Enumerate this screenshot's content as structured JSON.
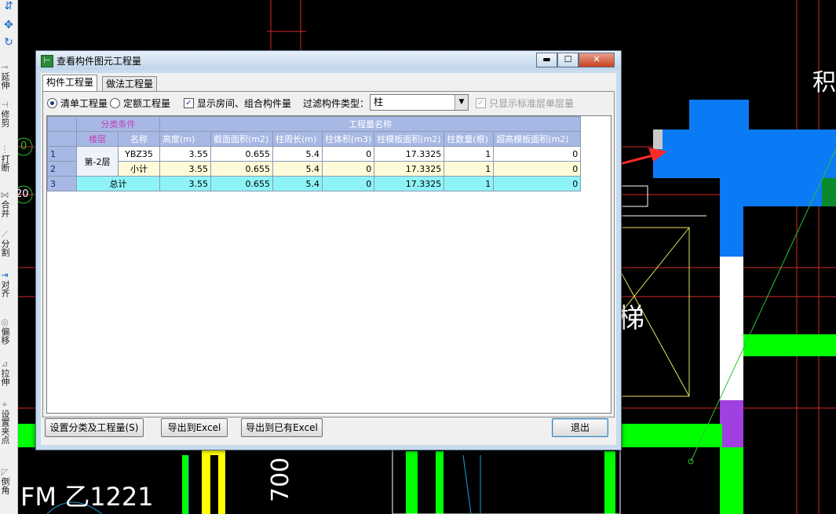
{
  "toolbar": {
    "items": [
      "延伸",
      "修剪",
      "打断",
      "合并",
      "分割",
      "对齐",
      "偏移",
      "拉伸",
      "设置夹点",
      "倒角"
    ]
  },
  "cad": {
    "label_fm": "FM 乙1221",
    "label_700": "700",
    "label_ji": "积",
    "label_ti": "梯",
    "label_axis_1": "0",
    "label_axis_2": "20"
  },
  "dialog": {
    "title": "查看构件图元工程量",
    "window_buttons": {
      "minimize": "▬",
      "maximize": "☐",
      "close": "✕"
    },
    "tabs": [
      "构件工程量",
      "做法工程量"
    ],
    "options": {
      "radio_list": "清单工程量",
      "radio_quota": "定额工程量",
      "check_rooms": "显示房间、组合构件量",
      "filter_label": "过滤构件类型：",
      "filter_value": "柱",
      "check_standard": "只显示标准层单层量"
    },
    "table": {
      "group_header": "分类条件",
      "qty_header": "工程量名称",
      "col_floor": "楼层",
      "col_name": "名称",
      "columns": [
        "高度(m)",
        "截面面积(m2)",
        "柱周长(m)",
        "柱体积(m3)",
        "柱模板面积(m2)",
        "柱数量(根)",
        "超高模板面积(m2)"
      ],
      "rows": [
        {
          "num": "1",
          "floor": "第-2层",
          "name": "YBZ35",
          "values": [
            "3.55",
            "0.655",
            "5.4",
            "0",
            "17.3325",
            "1",
            "0"
          ]
        },
        {
          "num": "2",
          "name": "小计",
          "values": [
            "3.55",
            "0.655",
            "5.4",
            "0",
            "17.3325",
            "1",
            "0"
          ]
        },
        {
          "num": "3",
          "name": "总计",
          "values": [
            "3.55",
            "0.655",
            "5.4",
            "0",
            "17.3325",
            "1",
            "0"
          ]
        }
      ]
    },
    "buttons": {
      "setup": "设置分类及工程量(S)",
      "export": "导出到Excel",
      "export_existing": "导出到已有Excel",
      "exit": "退出"
    }
  },
  "colors": {
    "grid_header": "#a7b8e4",
    "subtotal_row": "#fffbd8",
    "total_row": "#8ef3f6",
    "cad_green": "#00ff00",
    "cad_blue": "#0a7af5",
    "cad_red": "#ff2a2a"
  }
}
